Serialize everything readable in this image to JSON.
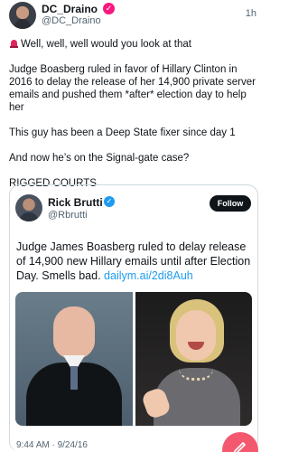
{
  "post": {
    "author_name": "DC_Draino",
    "author_handle": "@DC_Draino",
    "time": "1h",
    "paragraphs": [
      "Well, well, well would you look at that",
      "Judge Boasberg ruled in favor of Hillary Clinton in 2016 to delay the release of her 14,900 private server emails and pushed them *after* election day to help her",
      "This guy has been a Deep State fixer since day 1",
      "And now he’s on the Signal-gate case?",
      "RIGGED COURTS"
    ]
  },
  "quote": {
    "author_name": "Rick Brutti",
    "author_handle": "@Rbrutti",
    "follow_label": "Follow",
    "text": "Judge James Boasberg ruled to delay release of 14,900 new Hillary emails until after Election Day. Smells bad.",
    "link": "dailym.ai/2di8Auh",
    "timestamp": "9:44 AM · 9/24/16"
  },
  "icons": {
    "siren": "siren-icon",
    "verified_main": "verified-badge-icon",
    "verified_quote": "verified-badge-icon",
    "compose": "compose-icon"
  },
  "colors": {
    "accent": "#1d9bf0",
    "fab": "#f4586f",
    "verified_main": "#f91880",
    "text": "#0f1419",
    "muted": "#536471"
  }
}
